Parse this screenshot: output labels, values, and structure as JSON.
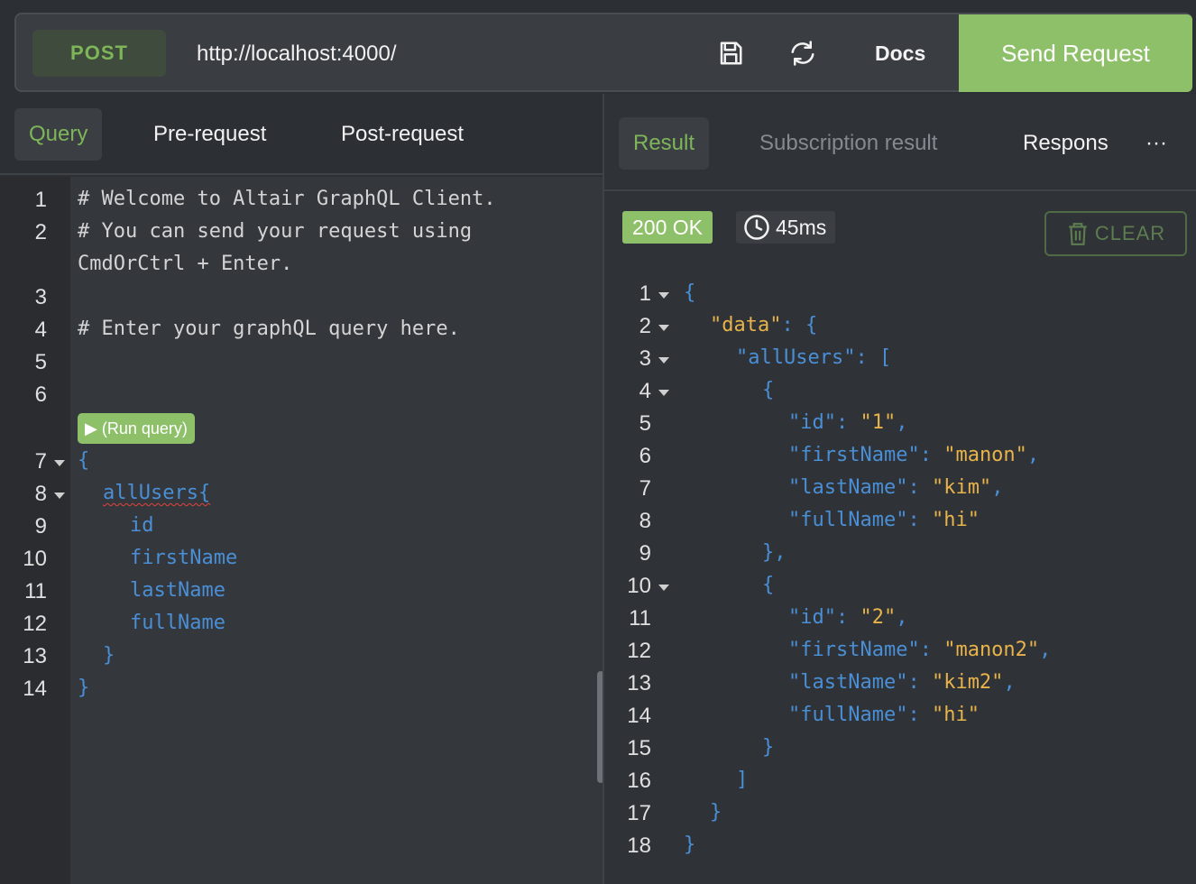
{
  "request": {
    "method": "POST",
    "url": "http://localhost:4000/",
    "docs_label": "Docs",
    "send_label": "Send Request",
    "icons": [
      "save-icon",
      "refresh-icon"
    ]
  },
  "left_tabs": [
    "Query",
    "Pre-request",
    "Post-request"
  ],
  "editor": {
    "line_numbers": [
      "1",
      "2",
      "3",
      "4",
      "5",
      "6",
      "7",
      "8",
      "9",
      "10",
      "11",
      "12",
      "13",
      "14"
    ],
    "comments": [
      "# Welcome to Altair GraphQL Client.",
      "# You can send your request using",
      "CmdOrCtrl + Enter.",
      "# Enter your graphQL query here."
    ],
    "run_query_label": "▶ (Run query)",
    "query": {
      "open_brace": "{",
      "root_field": "allUsers{",
      "fields": [
        "id",
        "firstName",
        "lastName",
        "fullName"
      ],
      "close_inner": "}",
      "close_outer": "}"
    }
  },
  "right_tabs": [
    "Result",
    "Subscription result",
    "Respons"
  ],
  "more_label": "···",
  "response": {
    "status": "200 OK",
    "time": "45ms",
    "clear_label": "CLEAR",
    "line_numbers": [
      "1",
      "2",
      "3",
      "4",
      "5",
      "6",
      "7",
      "8",
      "9",
      "10",
      "11",
      "12",
      "13",
      "14",
      "15",
      "16",
      "17",
      "18"
    ],
    "lines": [
      {
        "k": "",
        "v": "{"
      },
      {
        "k": "\"data\"",
        "v": ": {"
      },
      {
        "k": "\"allUsers\"",
        "v": ": ["
      },
      {
        "k": "",
        "v": "{"
      },
      {
        "k": "\"id\"",
        "v": "\"1\""
      },
      {
        "k": "\"firstName\"",
        "v": "\"manon\""
      },
      {
        "k": "\"lastName\"",
        "v": "\"kim\""
      },
      {
        "k": "\"fullName\"",
        "v": "\"hi\""
      },
      {
        "k": "",
        "v": "},"
      },
      {
        "k": "",
        "v": "{"
      },
      {
        "k": "\"id\"",
        "v": "\"2\""
      },
      {
        "k": "\"firstName\"",
        "v": "\"manon2\""
      },
      {
        "k": "\"lastName\"",
        "v": "\"kim2\""
      },
      {
        "k": "\"fullName\"",
        "v": "\"hi\""
      },
      {
        "k": "",
        "v": "}"
      },
      {
        "k": "",
        "v": "]"
      },
      {
        "k": "",
        "v": "}"
      },
      {
        "k": "",
        "v": "}"
      }
    ]
  },
  "colors": {
    "accent": "#8ec06a",
    "accent_text": "#7eb559",
    "key": "#4a8fd6",
    "string": "#e7b34a"
  }
}
